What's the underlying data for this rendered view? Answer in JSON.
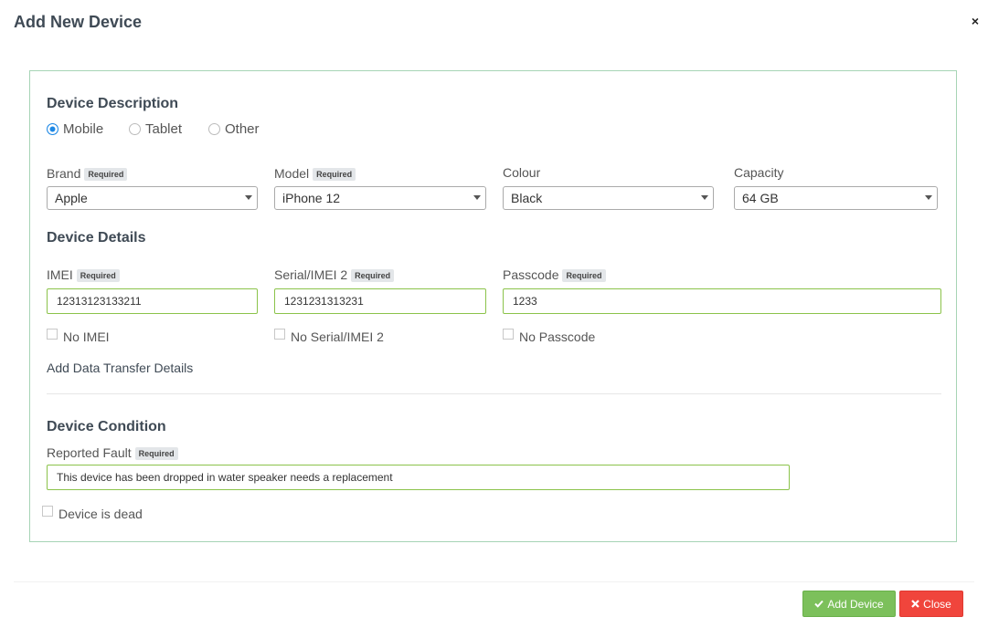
{
  "modal": {
    "title": "Add New Device",
    "close_glyph": "×"
  },
  "device_description": {
    "title": "Device Description",
    "types": [
      {
        "label": "Mobile",
        "checked": true
      },
      {
        "label": "Tablet",
        "checked": false
      },
      {
        "label": "Other",
        "checked": false
      }
    ]
  },
  "selects": {
    "brand": {
      "label": "Brand",
      "required": "Required",
      "value": "Apple"
    },
    "model": {
      "label": "Model",
      "required": "Required",
      "value": "iPhone 12"
    },
    "colour": {
      "label": "Colour",
      "value": "Black"
    },
    "capacity": {
      "label": "Capacity",
      "value": "64 GB"
    }
  },
  "device_details": {
    "title": "Device Details",
    "imei": {
      "label": "IMEI",
      "required": "Required",
      "value": "12313123133211",
      "no_label": "No IMEI"
    },
    "serial": {
      "label": "Serial/IMEI 2",
      "required": "Required",
      "value": "1231231313231",
      "no_label": "No Serial/IMEI 2"
    },
    "passcode": {
      "label": "Passcode",
      "required": "Required",
      "value": "1233",
      "no_label": "No Passcode"
    },
    "data_transfer_link": "Add Data Transfer Details"
  },
  "device_condition": {
    "title": "Device Condition",
    "fault": {
      "label": "Reported Fault",
      "required": "Required",
      "value": "This device has been dropped in water speaker needs a replacement"
    },
    "dead_label": "Device is dead"
  },
  "footer": {
    "add_label": "Add Device",
    "add_icon": "check-icon",
    "close_label": "Close",
    "close_icon": "times-icon"
  },
  "colors": {
    "accent_green": "#7cc05b",
    "danger_red": "#f0453c",
    "radio_blue": "#1e88e5",
    "valid_border": "#8bc34a"
  }
}
